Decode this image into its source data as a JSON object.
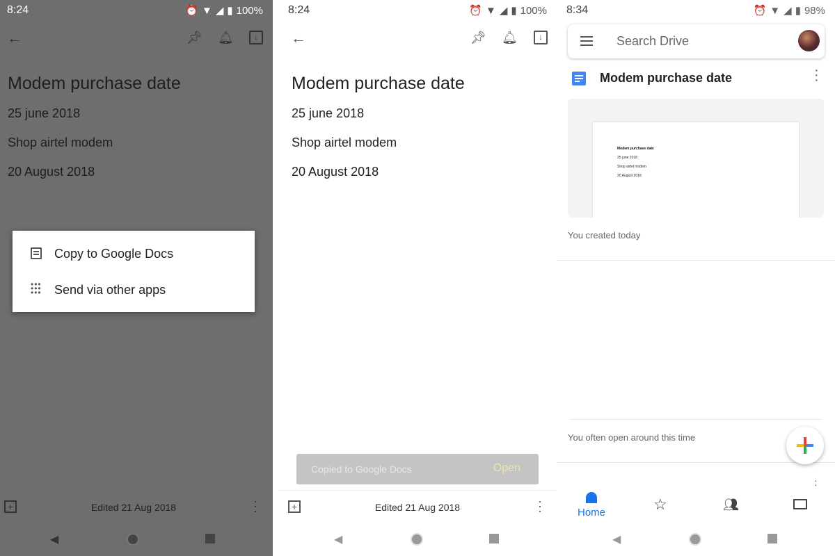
{
  "keep_dimmed": {
    "status": {
      "time": "8:24",
      "battery": "100%"
    },
    "note": {
      "title": "Modem purchase date",
      "lines": [
        "25 june 2018",
        "Shop airtel modem",
        "20 August 2018"
      ]
    },
    "menu": {
      "items": [
        {
          "label": "Copy to Google Docs",
          "icon": "document-icon"
        },
        {
          "label": "Send via other apps",
          "icon": "apps-grid-icon"
        }
      ]
    },
    "footer": {
      "edited": "Edited 21 Aug 2018"
    }
  },
  "keep": {
    "status": {
      "time": "8:24",
      "battery": "100%"
    },
    "note": {
      "title": "Modem purchase date",
      "lines": [
        "25 june 2018",
        "Shop airtel modem",
        "20 August 2018"
      ]
    },
    "snackbar": {
      "message": "Copied to Google Docs",
      "action": "Open"
    },
    "footer": {
      "edited": "Edited 21 Aug 2018"
    }
  },
  "drive": {
    "status": {
      "time": "8:34",
      "battery": "98%"
    },
    "search": {
      "placeholder": "Search Drive"
    },
    "file": {
      "name": "Modem purchase date",
      "preview_title": "Modem purchase date",
      "preview_lines": [
        "25 june 2018",
        "Shop airtel modem",
        "20 August 2018"
      ],
      "caption": "You created today"
    },
    "suggestion": "You often open around this time",
    "nav": {
      "home": "Home",
      "active": "home"
    },
    "colors": {
      "accent": "#1a73e8",
      "docs_blue": "#4285f4"
    }
  }
}
